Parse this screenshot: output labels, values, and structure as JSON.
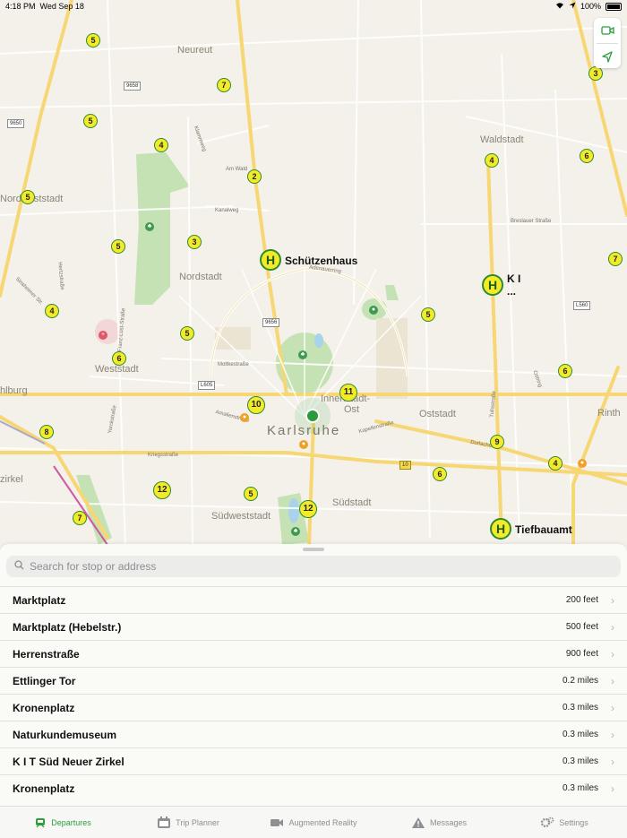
{
  "status_bar": {
    "time": "4:18 PM",
    "date": "Wed Sep 18",
    "battery": "100%"
  },
  "map": {
    "places": {
      "neureut": "Neureut",
      "waldstadt": "Waldstadt",
      "nordweststadt": "Nordweststadt",
      "nordstadt": "Nordstadt",
      "weststadt": "Weststadt",
      "innenstadt_ost_1": "Innenstadt-",
      "innenstadt_ost_2": "Ost",
      "karlsruhe": "Karlsruhe",
      "oststadt": "Oststadt",
      "suedweststadt": "Südweststadt",
      "suedstadt": "Südstadt",
      "rinth": "Rinth",
      "hlburg": "hlburg",
      "zirkel": "zirkel"
    },
    "streets": {
      "am_wald": "Am Wald",
      "kanalweg": "Kanalweg",
      "klammweg": "Klammweg",
      "breslauer": "Breslauer Straße",
      "adenauerring": "Adenauerring",
      "moltkestrasse": "Moltkestraße",
      "kriegsstrasse": "Kriegsstraße",
      "kapellenstrasse": "Kapellenstraße",
      "durlacher": "Durlacher",
      "ostring": "Ostring",
      "tullastrasse": "Tullastraße",
      "amalienstrasse": "Amalienstraße",
      "yorckstrasse": "Yorckstraße",
      "hertzstrasse": "Hertzstraße",
      "sinsheimer": "Sinsheimer Str.",
      "franz_lust": "Franz-Lust-Straße"
    },
    "route_shields": {
      "r9658": "9658",
      "r9650": "9650",
      "r9656": "9656",
      "l605": "L605",
      "l560": "L560",
      "r10": "10"
    },
    "line_badges": {
      "b1": "5",
      "b2": "7",
      "b3": "5",
      "b4": "4",
      "b5": "5",
      "b6": "2",
      "b7": "3",
      "b8": "5",
      "b9": "4",
      "b10": "5",
      "b11": "6",
      "b12": "10",
      "b13": "11",
      "b14": "8",
      "b15": "12",
      "b16": "5",
      "b17": "12",
      "b18": "7",
      "b19": "3",
      "b20": "4",
      "b21": "6",
      "b22": "7",
      "b23": "5",
      "b24": "6",
      "b25": "9",
      "b26": "4",
      "b27": "6"
    },
    "stops": {
      "schuetzenhaus": "Schützenhaus",
      "kit": "K I",
      "kit_more": "...",
      "tiefbauamt": "Tiefbauamt"
    },
    "stop_marker": "H"
  },
  "search": {
    "placeholder": "Search for stop or address"
  },
  "stops_list": [
    {
      "name": "Marktplatz",
      "distance": "200 feet"
    },
    {
      "name": "Marktplatz (Hebelstr.)",
      "distance": "500 feet"
    },
    {
      "name": "Herrenstraße",
      "distance": "900 feet"
    },
    {
      "name": "Ettlinger Tor",
      "distance": "0.2 miles"
    },
    {
      "name": "Kronenplatz",
      "distance": "0.3 miles"
    },
    {
      "name": "Naturkundemuseum",
      "distance": "0.3 miles"
    },
    {
      "name": "K I T Süd Neuer Zirkel",
      "distance": "0.3 miles"
    },
    {
      "name": "Kronenplatz",
      "distance": "0.3 miles"
    }
  ],
  "tabs": [
    {
      "label": "Departures",
      "icon": "tram-icon"
    },
    {
      "label": "Trip Planner",
      "icon": "calendar-icon"
    },
    {
      "label": "Augmented Reality",
      "icon": "video-camera-icon"
    },
    {
      "label": "Messages",
      "icon": "warning-icon"
    },
    {
      "label": "Settings",
      "icon": "gear-icon"
    }
  ],
  "colors": {
    "accent": "#2f9e3f",
    "badge_fill": "#f3eb2a",
    "badge_border": "#2d8a2d",
    "road": "#f7d774",
    "park": "#c4e2b4"
  }
}
